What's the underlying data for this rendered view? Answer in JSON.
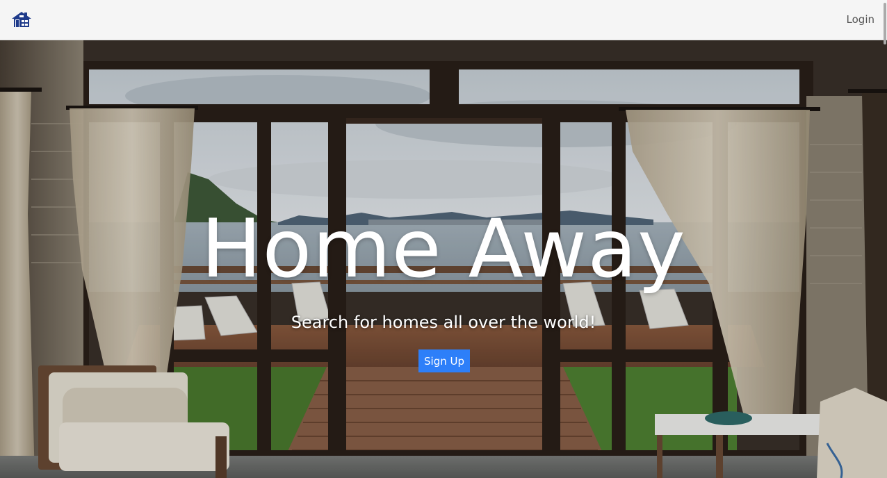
{
  "nav": {
    "logo_icon": "house-icon",
    "login_label": "Login",
    "brand_color": "#1e3a8a"
  },
  "hero": {
    "title": "Home Away",
    "subtitle": "Search for homes all over the world!",
    "signup_label": "Sign Up",
    "accent_color": "#2d7ff9"
  }
}
